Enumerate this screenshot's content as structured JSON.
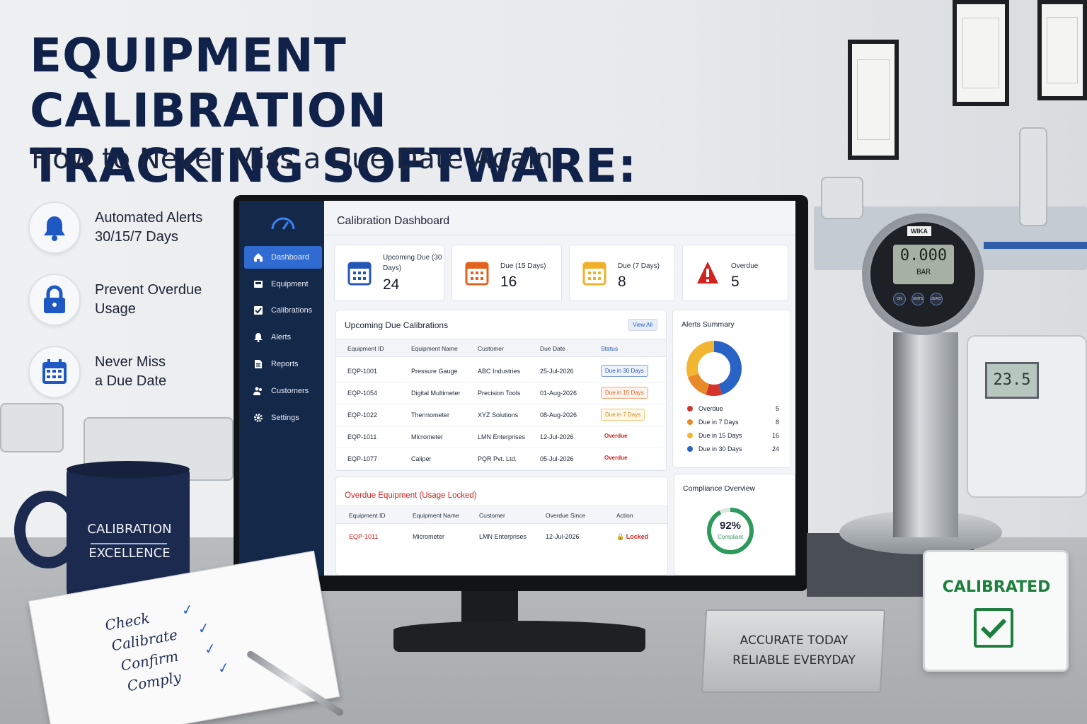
{
  "headline": {
    "title_line1": "EQUIPMENT CALIBRATION",
    "title_line2": "TRACKING SOFTWARE:",
    "subtitle": "How to Never Miss a Due Date Again"
  },
  "features": [
    {
      "icon": "bell-icon",
      "line1": "Automated Alerts",
      "line2": "30/15/7 Days"
    },
    {
      "icon": "lock-icon",
      "line1": "Prevent Overdue",
      "line2": "Usage"
    },
    {
      "icon": "calendar-icon",
      "line1": "Never Miss",
      "line2": "a Due Date"
    }
  ],
  "sidebar": {
    "items": [
      {
        "label": "Dashboard",
        "icon": "home-icon",
        "active": true
      },
      {
        "label": "Equipment",
        "icon": "equipment-icon"
      },
      {
        "label": "Calibrations",
        "icon": "checklist-icon"
      },
      {
        "label": "Alerts",
        "icon": "bell-icon"
      },
      {
        "label": "Reports",
        "icon": "report-icon"
      },
      {
        "label": "Customers",
        "icon": "users-icon"
      },
      {
        "label": "Settings",
        "icon": "gear-icon"
      }
    ]
  },
  "dashboard": {
    "title": "Calibration Dashboard",
    "stats": [
      {
        "label": "Upcoming Due (30 Days)",
        "value": "24",
        "color": "#2456b8"
      },
      {
        "label": "Due (15 Days)",
        "value": "16",
        "color": "#e0621c"
      },
      {
        "label": "Due (7 Days)",
        "value": "8",
        "color": "#f0b029"
      },
      {
        "label": "Overdue",
        "value": "5",
        "color": "#d3231f"
      }
    ],
    "upcoming": {
      "title": "Upcoming Due Calibrations",
      "view_all": "View All",
      "headers": [
        "Equipment ID",
        "Equipment Name",
        "Customer",
        "Due Date",
        "Status"
      ],
      "rows": [
        {
          "id": "EQP-1001",
          "name": "Pressure Gauge",
          "customer": "ABC Industries",
          "due": "25-Jul-2026",
          "status": "Due in 30 Days"
        },
        {
          "id": "EQP-1054",
          "name": "Digital Multimeter",
          "customer": "Precision Tools",
          "due": "01-Aug-2026",
          "status": "Due in 15 Days"
        },
        {
          "id": "EQP-1022",
          "name": "Thermometer",
          "customer": "XYZ Solutions",
          "due": "08-Aug-2026",
          "status": "Due in 7 Days"
        },
        {
          "id": "EQP-1011",
          "name": "Micrometer",
          "customer": "LMN Enterprises",
          "due": "12-Jul-2026",
          "status": "Overdue"
        },
        {
          "id": "EQP-1077",
          "name": "Caliper",
          "customer": "PQR Pvt. Ltd.",
          "due": "05-Jul-2026",
          "status": "Overdue"
        }
      ]
    },
    "overdue": {
      "title": "Overdue Equipment (Usage Locked)",
      "headers": [
        "Equipment ID",
        "Equipment Name",
        "Customer",
        "Overdue Since",
        "Action"
      ],
      "rows": [
        {
          "id": "EQP-1011",
          "name": "Micrometer",
          "customer": "LMN Enterprises",
          "since": "12-Jul-2026",
          "action": "Locked"
        }
      ]
    },
    "alerts": {
      "title": "Alerts Summary",
      "items": [
        {
          "label": "Overdue",
          "value": 5,
          "color": "#d3342c"
        },
        {
          "label": "Due in 7 Days",
          "value": 8,
          "color": "#e98a2a"
        },
        {
          "label": "Due in 15 Days",
          "value": 16,
          "color": "#f2b632"
        },
        {
          "label": "Due in 30 Days",
          "value": 24,
          "color": "#2a63c6"
        }
      ]
    },
    "compliance": {
      "title": "Compliance Overview",
      "percent_text": "92%",
      "percent": 0.92,
      "caption": "Compliant"
    }
  },
  "desk": {
    "mug_line1": "CALIBRATION",
    "mug_line2": "EXCELLENCE",
    "notes": [
      "Check",
      "Calibrate",
      "Confirm",
      "Comply"
    ],
    "plate_line1": "ACCURATE TODAY",
    "plate_line2": "RELIABLE EVERYDAY",
    "tent_label": "CALIBRATED",
    "gauge_brand": "WIKA",
    "gauge_reading": "0.000",
    "gauge_unit": "BAR",
    "gauge_buttons": [
      "ON",
      "UNITS",
      "ZERO"
    ],
    "device_reading": "23.5"
  },
  "colors": {
    "navy": "#10224a",
    "sidebar": "#14284a",
    "accent": "#2f6bd0",
    "overdue_red": "#d3231f",
    "compliance_green": "#2c9a5b"
  }
}
